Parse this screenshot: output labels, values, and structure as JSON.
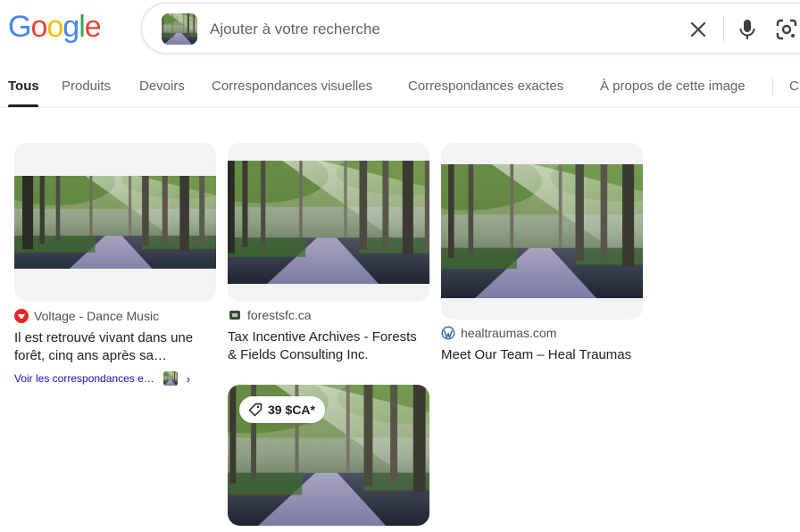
{
  "logo": {
    "text": "Google"
  },
  "search": {
    "placeholder": "Ajouter à votre recherche",
    "value": ""
  },
  "icons": {
    "close": "close-icon",
    "mic": "microphone-icon",
    "lens": "google-lens-icon",
    "tag": "price-tag-icon",
    "chevron": "chevron-right-icon"
  },
  "tabs": [
    {
      "label": "Tous",
      "active": true
    },
    {
      "label": "Produits"
    },
    {
      "label": "Devoirs"
    },
    {
      "label": "Correspondances visuelles"
    },
    {
      "label": "Correspondances exactes"
    },
    {
      "label": "À propos de cette image"
    },
    {
      "label": "C"
    }
  ],
  "results": [
    {
      "source": "Voltage - Dance Music",
      "title_line1": "Il est retrouvé vivant dans une",
      "title_line2": "forêt, cinq ans après sa…",
      "more_link": "Voir les correspondances e…"
    },
    {
      "source": "forestsfc.ca",
      "title_line1": "Tax Incentive Archives - Forests",
      "title_line2": "& Fields Consulting Inc."
    },
    {
      "source": "healtraumas.com",
      "title_line1": "Meet Our Team – Heal Traumas"
    },
    {
      "price": "39 $CA*"
    }
  ],
  "colors": {
    "google_blue": "#4285F4",
    "google_red": "#EA4335",
    "google_yellow": "#FBBC05",
    "google_green": "#34A853",
    "link": "#1a0dab"
  }
}
